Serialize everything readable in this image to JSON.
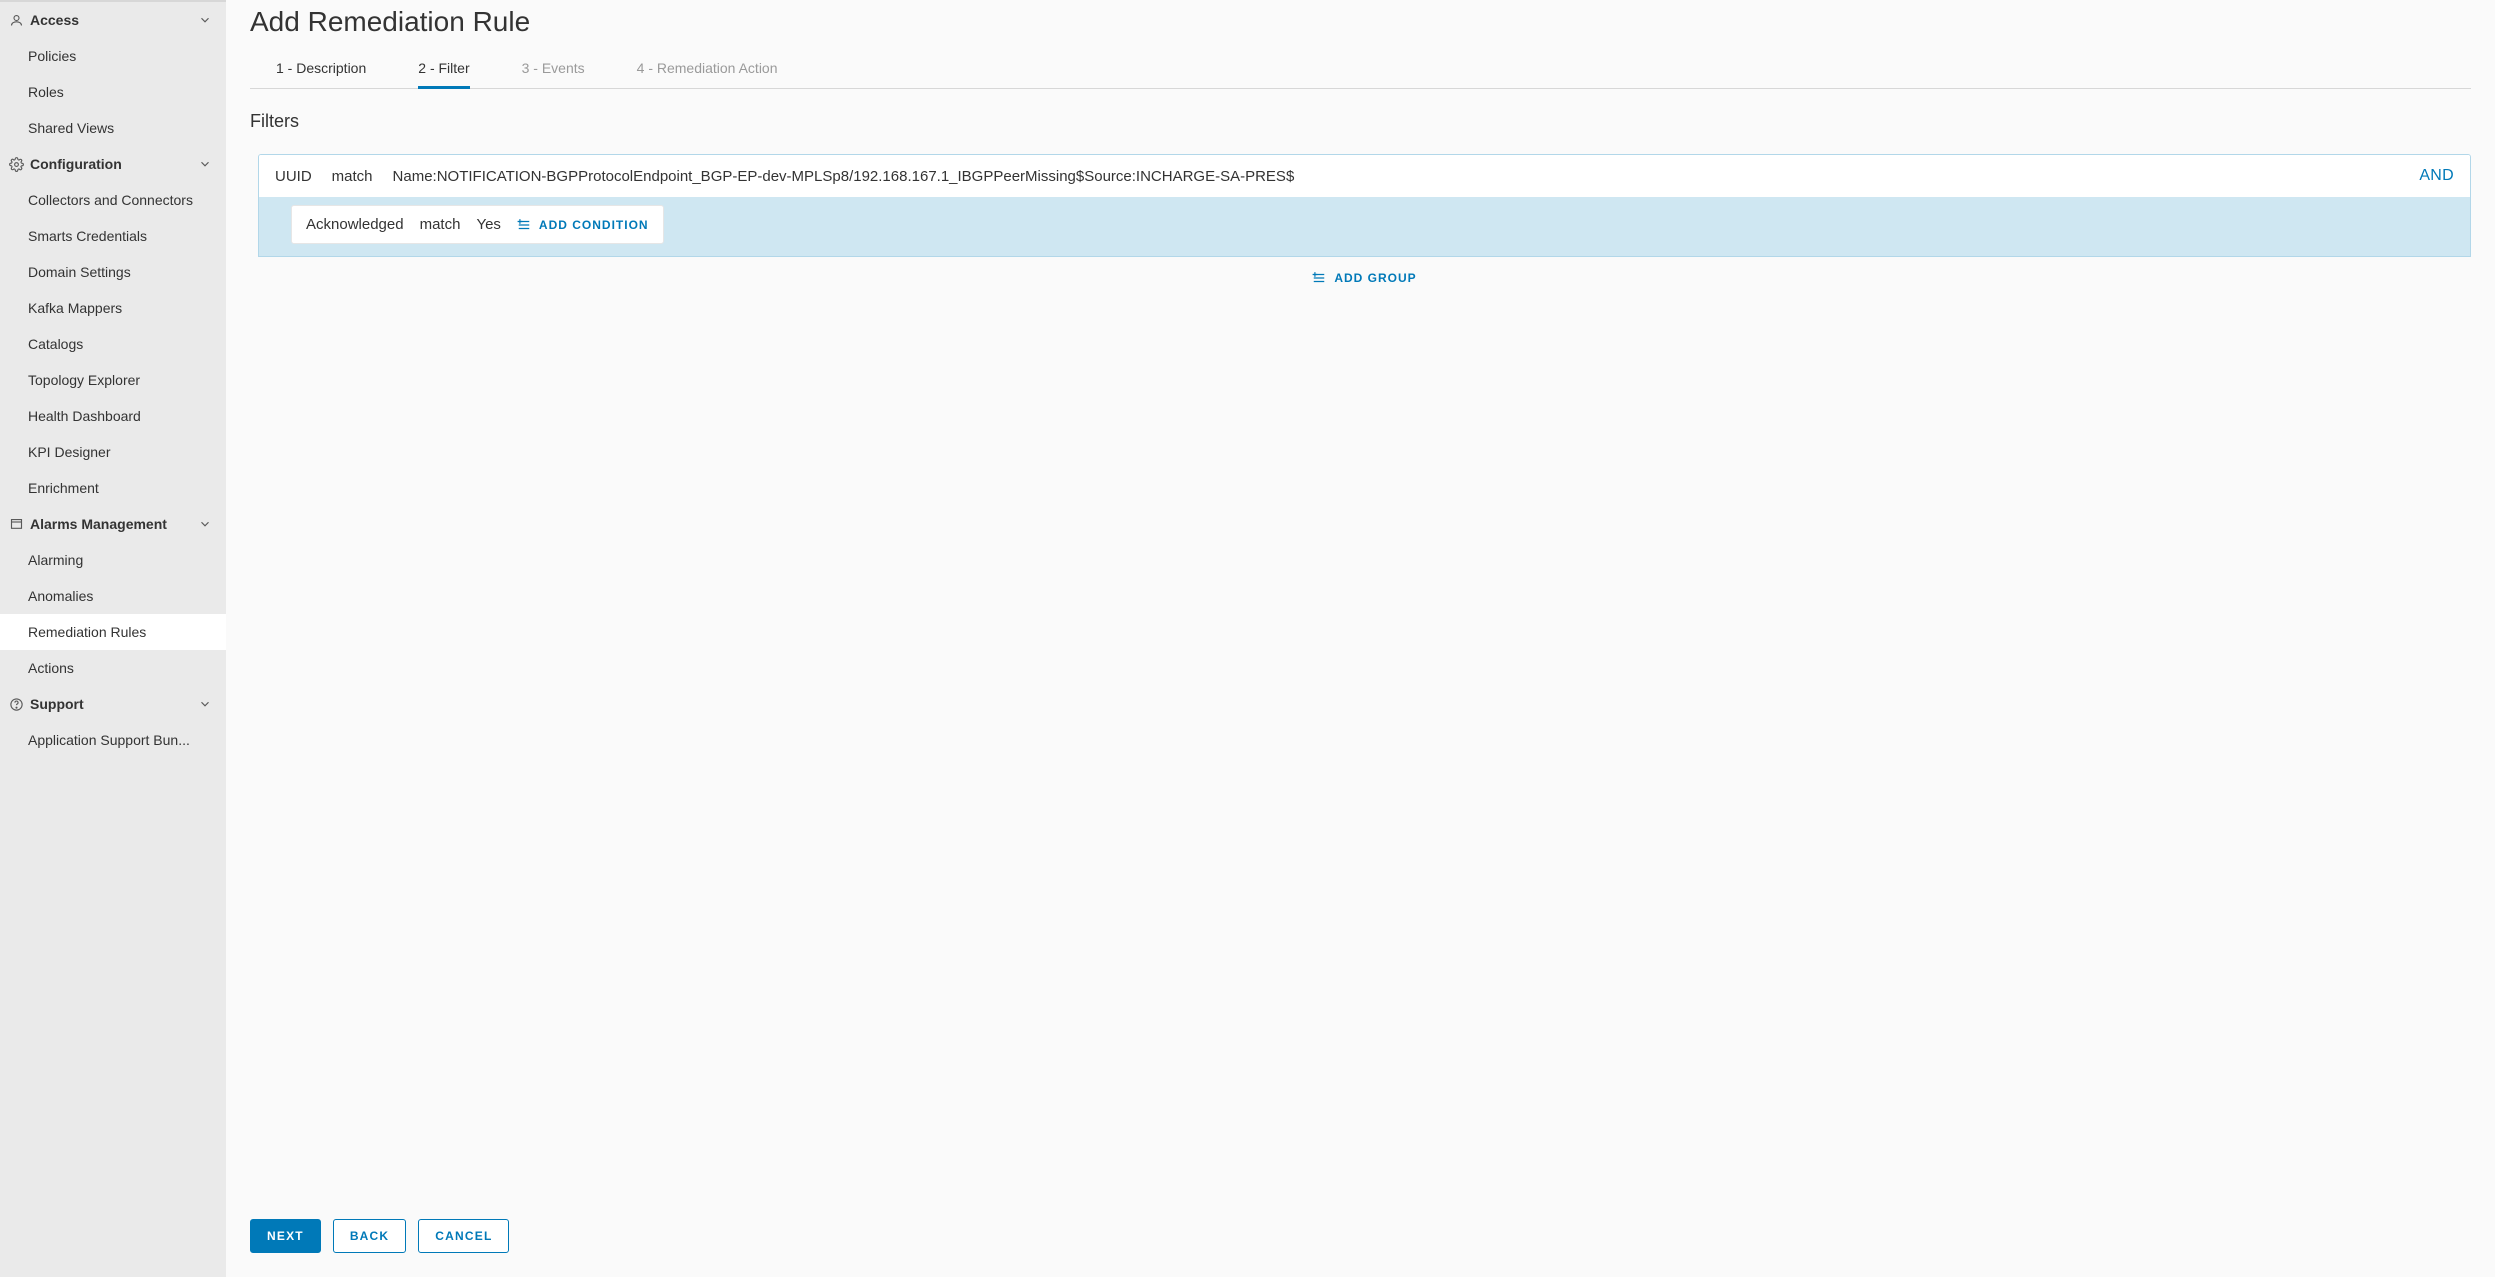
{
  "sidebar": {
    "groups": [
      {
        "key": "access",
        "label": "Access",
        "icon": "user-icon",
        "items": [
          {
            "label": "Policies"
          },
          {
            "label": "Roles"
          },
          {
            "label": "Shared Views"
          }
        ]
      },
      {
        "key": "configuration",
        "label": "Configuration",
        "icon": "gear-icon",
        "items": [
          {
            "label": "Collectors and Connectors"
          },
          {
            "label": "Smarts Credentials"
          },
          {
            "label": "Domain Settings"
          },
          {
            "label": "Kafka Mappers"
          },
          {
            "label": "Catalogs"
          },
          {
            "label": "Topology Explorer"
          },
          {
            "label": "Health Dashboard"
          },
          {
            "label": "KPI Designer"
          },
          {
            "label": "Enrichment"
          }
        ]
      },
      {
        "key": "alarms",
        "label": "Alarms Management",
        "icon": "alarm-icon",
        "items": [
          {
            "label": "Alarming"
          },
          {
            "label": "Anomalies"
          },
          {
            "label": "Remediation Rules",
            "selected": true
          },
          {
            "label": "Actions"
          }
        ]
      },
      {
        "key": "support",
        "label": "Support",
        "icon": "help-icon",
        "items": [
          {
            "label": "Application Support Bun..."
          }
        ]
      }
    ]
  },
  "page": {
    "title": "Add Remediation Rule",
    "tabs": {
      "t1": "1 - Description",
      "t2": "2 - Filter",
      "t3": "3 - Events",
      "t4": "4 - Remediation Action"
    },
    "section_title": "Filters"
  },
  "filter": {
    "row1": {
      "field": "UUID",
      "op": "match",
      "value": "Name:NOTIFICATION-BGPProtocolEndpoint_BGP-EP-dev-MPLSp8/192.168.167.1_IBGPPeerMissing$Source:INCHARGE-SA-PRES$",
      "logic": "AND"
    },
    "row2": {
      "field": "Acknowledged",
      "op": "match",
      "value": "Yes"
    },
    "add_condition": "ADD CONDITION",
    "add_group": "ADD GROUP"
  },
  "buttons": {
    "next": "NEXT",
    "back": "BACK",
    "cancel": "CANCEL"
  }
}
